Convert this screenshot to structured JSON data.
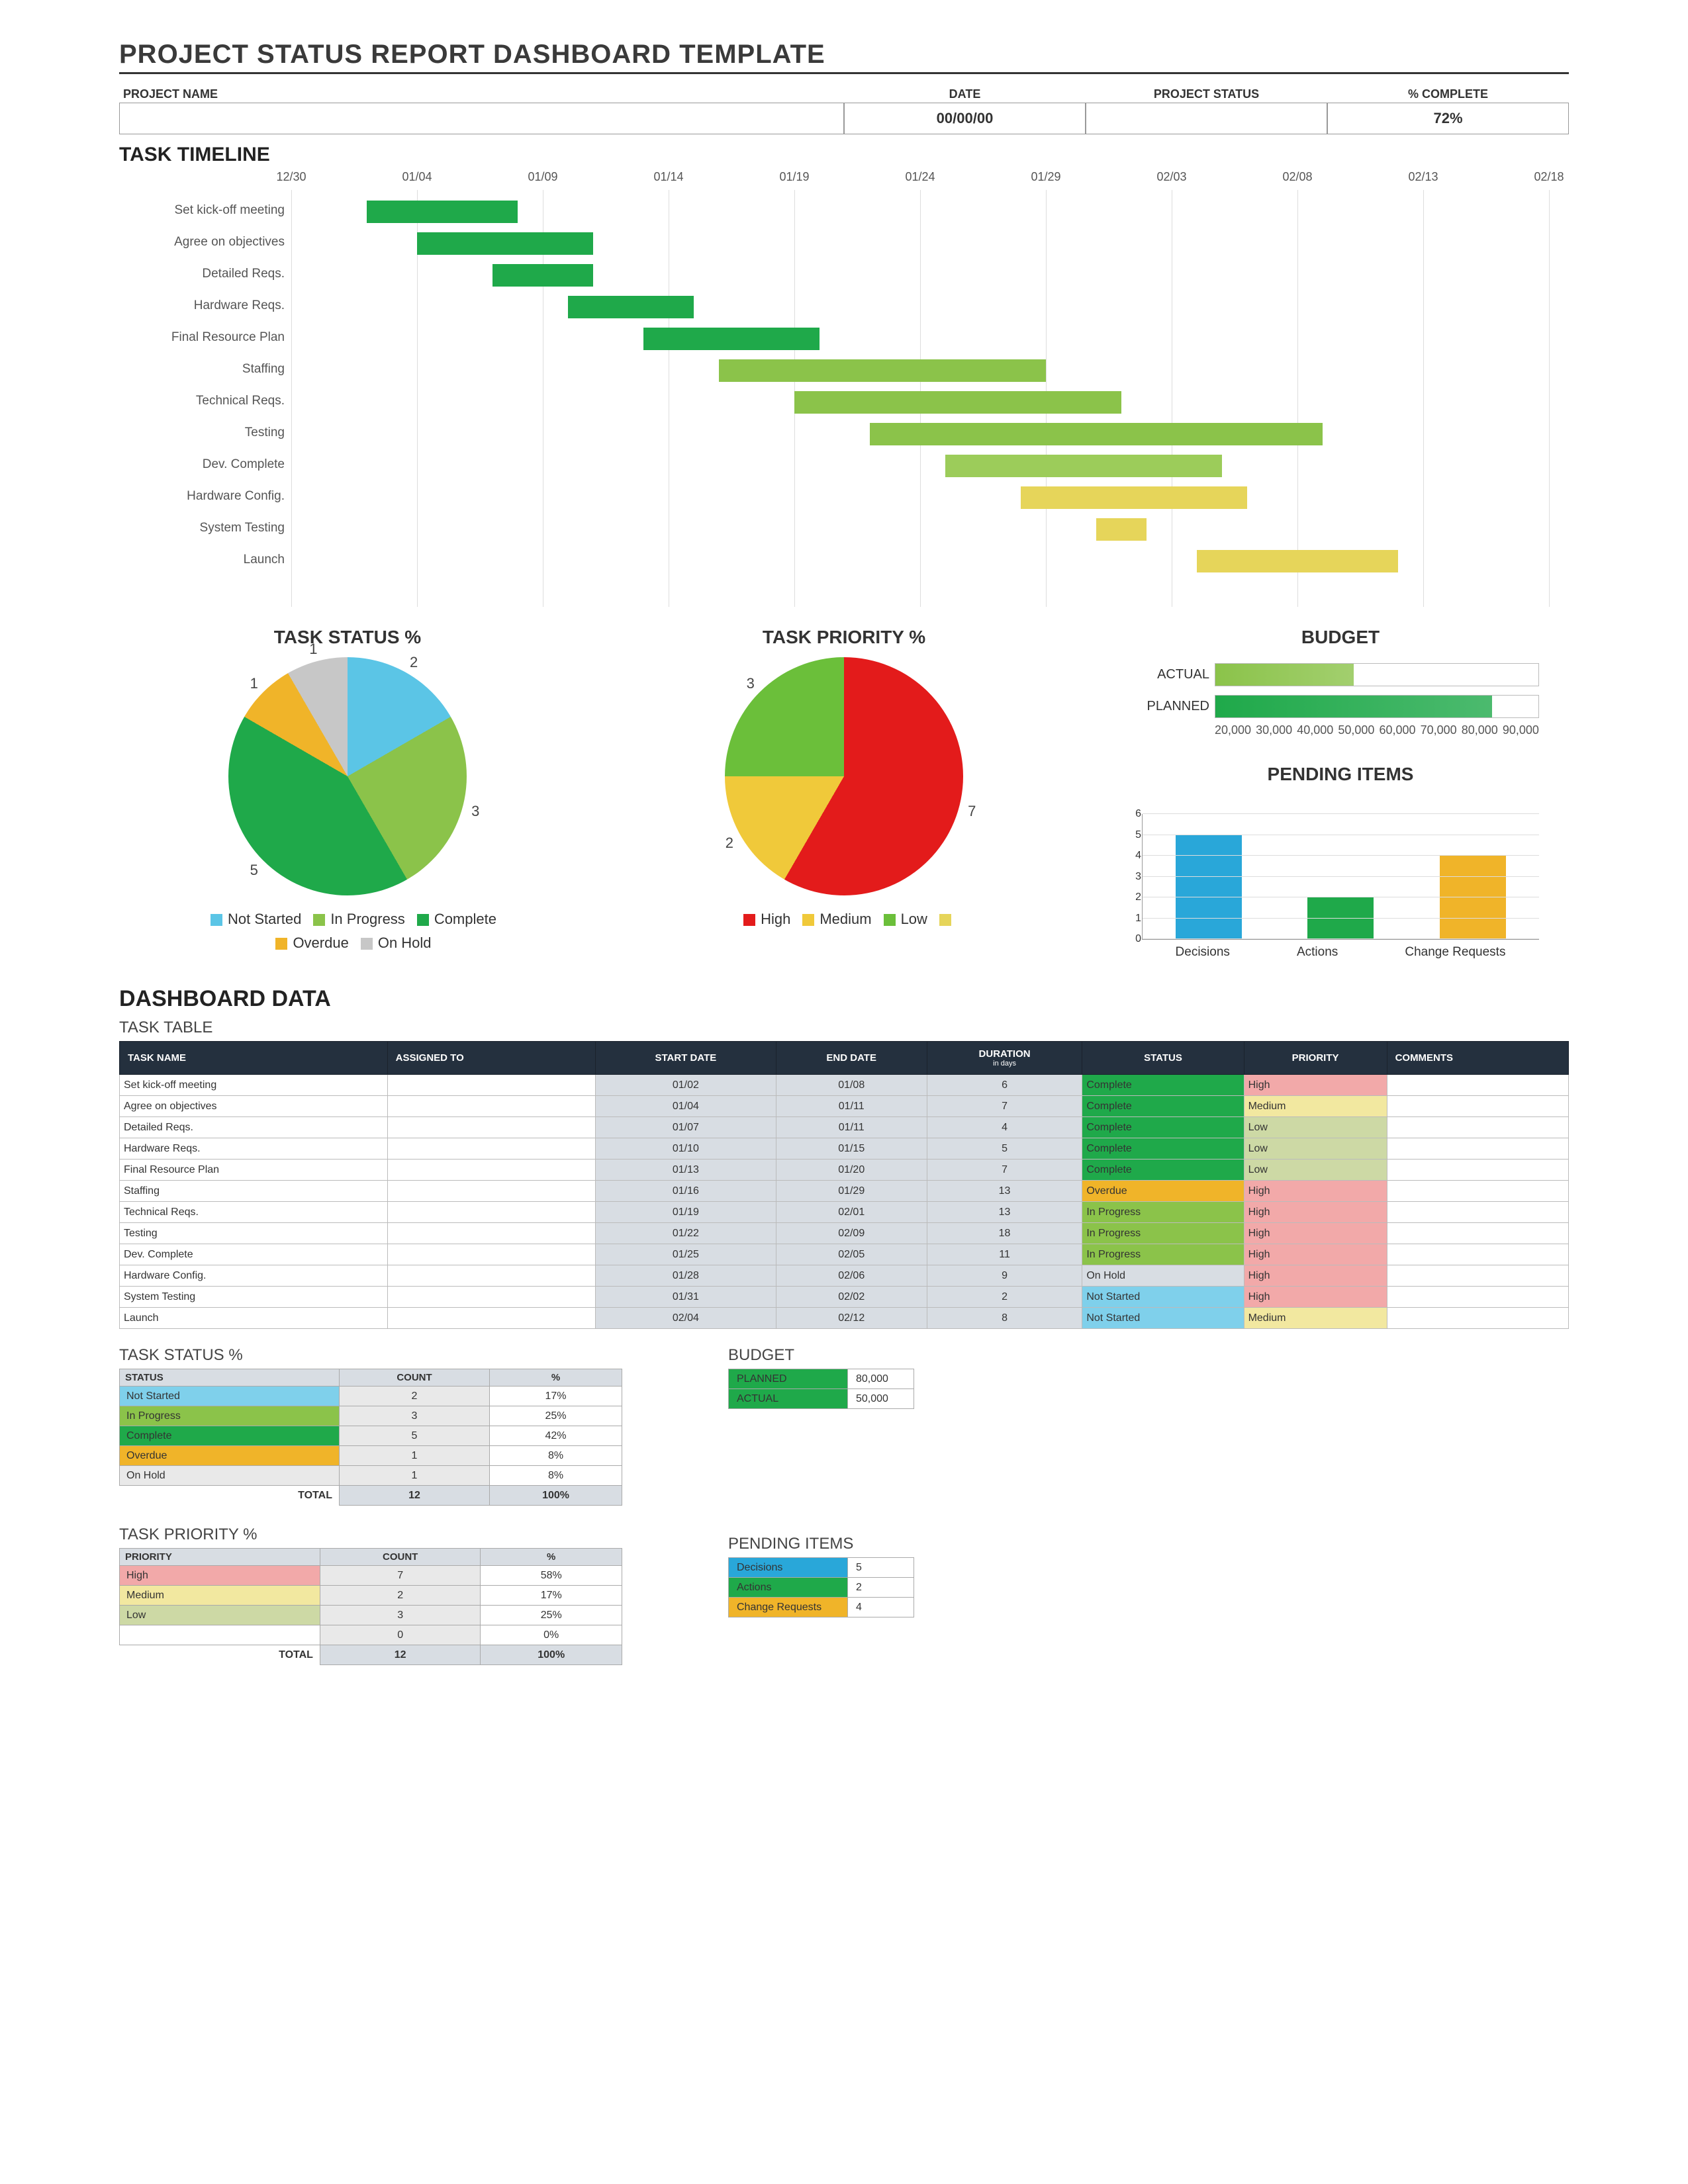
{
  "page_title": "PROJECT STATUS REPORT DASHBOARD TEMPLATE",
  "header": {
    "project_name": {
      "label": "PROJECT NAME",
      "value": ""
    },
    "date": {
      "label": "DATE",
      "value": "00/00/00"
    },
    "status": {
      "label": "PROJECT STATUS",
      "value": ""
    },
    "complete": {
      "label": "% COMPLETE",
      "value": "72%"
    }
  },
  "timeline": {
    "title": "TASK TIMELINE",
    "dates": [
      "12/30",
      "01/04",
      "01/09",
      "01/14",
      "01/19",
      "01/24",
      "01/29",
      "02/03",
      "02/08",
      "02/13",
      "02/18"
    ],
    "tasks": [
      {
        "name": "Set kick-off meeting",
        "start": "01/02",
        "end": "01/08",
        "color": "#1fa94a"
      },
      {
        "name": "Agree on objectives",
        "start": "01/04",
        "end": "01/11",
        "color": "#1fa94a"
      },
      {
        "name": "Detailed Reqs.",
        "start": "01/07",
        "end": "01/11",
        "color": "#1fa94a"
      },
      {
        "name": "Hardware Reqs.",
        "start": "01/10",
        "end": "01/15",
        "color": "#1fa94a"
      },
      {
        "name": "Final Resource Plan",
        "start": "01/13",
        "end": "01/20",
        "color": "#1fa94a"
      },
      {
        "name": "Staffing",
        "start": "01/16",
        "end": "01/29",
        "color": "#8bc34a"
      },
      {
        "name": "Technical Reqs.",
        "start": "01/19",
        "end": "02/01",
        "color": "#8bc34a"
      },
      {
        "name": "Testing",
        "start": "01/22",
        "end": "02/09",
        "color": "#8bc34a"
      },
      {
        "name": "Dev. Complete",
        "start": "01/25",
        "end": "02/05",
        "color": "#9ccc5a"
      },
      {
        "name": "Hardware Config.",
        "start": "01/28",
        "end": "02/06",
        "color": "#e6d55a"
      },
      {
        "name": "System Testing",
        "start": "01/31",
        "end": "02/02",
        "color": "#e6d55a"
      },
      {
        "name": "Launch",
        "start": "02/04",
        "end": "02/12",
        "color": "#e6d55a"
      }
    ]
  },
  "chart_data": [
    {
      "type": "pie",
      "title": "TASK STATUS %",
      "series": [
        {
          "name": "Not Started",
          "value": 2,
          "color": "#5bc5e6"
        },
        {
          "name": "In Progress",
          "value": 3,
          "color": "#8bc34a"
        },
        {
          "name": "Complete",
          "value": 5,
          "color": "#1fa94a"
        },
        {
          "name": "Overdue",
          "value": 1,
          "color": "#f0b429"
        },
        {
          "name": "On Hold",
          "value": 1,
          "color": "#c7c7c7"
        }
      ],
      "legend": [
        "Not Started",
        "In Progress",
        "Complete",
        "Overdue",
        "On Hold"
      ]
    },
    {
      "type": "pie",
      "title": "TASK PRIORITY %",
      "series": [
        {
          "name": "High",
          "value": 7,
          "color": "#e31b1b"
        },
        {
          "name": "Medium",
          "value": 2,
          "color": "#f0c93a"
        },
        {
          "name": "Low",
          "value": 3,
          "color": "#6bbf3a"
        },
        {
          "name": "",
          "value": 0,
          "color": "#e6d55a"
        }
      ],
      "legend": [
        "High",
        "Medium",
        "Low",
        ""
      ]
    },
    {
      "type": "bar",
      "title": "BUDGET",
      "orientation": "horizontal",
      "categories": [
        "ACTUAL",
        "PLANNED"
      ],
      "values": [
        50000,
        80000
      ],
      "colors": [
        "#8bc34a",
        "#1fa94a"
      ],
      "xticks": [
        20000,
        30000,
        40000,
        50000,
        60000,
        70000,
        80000,
        90000
      ]
    },
    {
      "type": "bar",
      "title": "PENDING ITEMS",
      "categories": [
        "Decisions",
        "Actions",
        "Change Requests"
      ],
      "values": [
        5,
        2,
        4
      ],
      "colors": [
        "#29a7d9",
        "#1fa94a",
        "#f0b429"
      ],
      "ylim": [
        0,
        6
      ],
      "yticks": [
        0,
        1,
        2,
        3,
        4,
        5,
        6
      ]
    }
  ],
  "dashboard_data_title": "DASHBOARD DATA",
  "task_table": {
    "title": "TASK TABLE",
    "headers": [
      "TASK NAME",
      "ASSIGNED TO",
      "START DATE",
      "END DATE",
      "DURATION in days",
      "STATUS",
      "PRIORITY",
      "COMMENTS"
    ],
    "rows": [
      {
        "name": "Set kick-off meeting",
        "assigned": "",
        "start": "01/02",
        "end": "01/08",
        "dur": "6",
        "status": "Complete",
        "status_bg": "#1fa94a",
        "priority": "High",
        "pri_bg": "#f2a9a9",
        "comments": ""
      },
      {
        "name": "Agree on objectives",
        "assigned": "",
        "start": "01/04",
        "end": "01/11",
        "dur": "7",
        "status": "Complete",
        "status_bg": "#1fa94a",
        "priority": "Medium",
        "pri_bg": "#f2e8a0",
        "comments": ""
      },
      {
        "name": "Detailed Reqs.",
        "assigned": "",
        "start": "01/07",
        "end": "01/11",
        "dur": "4",
        "status": "Complete",
        "status_bg": "#1fa94a",
        "priority": "Low",
        "pri_bg": "#cdd9a5",
        "comments": ""
      },
      {
        "name": "Hardware Reqs.",
        "assigned": "",
        "start": "01/10",
        "end": "01/15",
        "dur": "5",
        "status": "Complete",
        "status_bg": "#1fa94a",
        "priority": "Low",
        "pri_bg": "#cdd9a5",
        "comments": ""
      },
      {
        "name": "Final Resource Plan",
        "assigned": "",
        "start": "01/13",
        "end": "01/20",
        "dur": "7",
        "status": "Complete",
        "status_bg": "#1fa94a",
        "priority": "Low",
        "pri_bg": "#cdd9a5",
        "comments": ""
      },
      {
        "name": "Staffing",
        "assigned": "",
        "start": "01/16",
        "end": "01/29",
        "dur": "13",
        "status": "Overdue",
        "status_bg": "#f0b429",
        "priority": "High",
        "pri_bg": "#f2a9a9",
        "comments": ""
      },
      {
        "name": "Technical Reqs.",
        "assigned": "",
        "start": "01/19",
        "end": "02/01",
        "dur": "13",
        "status": "In Progress",
        "status_bg": "#8bc34a",
        "priority": "High",
        "pri_bg": "#f2a9a9",
        "comments": ""
      },
      {
        "name": "Testing",
        "assigned": "",
        "start": "01/22",
        "end": "02/09",
        "dur": "18",
        "status": "In Progress",
        "status_bg": "#8bc34a",
        "priority": "High",
        "pri_bg": "#f2a9a9",
        "comments": ""
      },
      {
        "name": "Dev. Complete",
        "assigned": "",
        "start": "01/25",
        "end": "02/05",
        "dur": "11",
        "status": "In Progress",
        "status_bg": "#8bc34a",
        "priority": "High",
        "pri_bg": "#f2a9a9",
        "comments": ""
      },
      {
        "name": "Hardware Config.",
        "assigned": "",
        "start": "01/28",
        "end": "02/06",
        "dur": "9",
        "status": "On Hold",
        "status_bg": "#d8dde3",
        "priority": "High",
        "pri_bg": "#f2a9a9",
        "comments": ""
      },
      {
        "name": "System Testing",
        "assigned": "",
        "start": "01/31",
        "end": "02/02",
        "dur": "2",
        "status": "Not Started",
        "status_bg": "#7fd0eb",
        "priority": "High",
        "pri_bg": "#f2a9a9",
        "comments": ""
      },
      {
        "name": "Launch",
        "assigned": "",
        "start": "02/04",
        "end": "02/12",
        "dur": "8",
        "status": "Not Started",
        "status_bg": "#7fd0eb",
        "priority": "Medium",
        "pri_bg": "#f2e8a0",
        "comments": ""
      }
    ]
  },
  "status_table": {
    "title": "TASK STATUS %",
    "headers": [
      "STATUS",
      "COUNT",
      "%"
    ],
    "rows": [
      {
        "label": "Not Started",
        "bg": "#7fd0eb",
        "count": 2,
        "pct": "17%"
      },
      {
        "label": "In Progress",
        "bg": "#8bc34a",
        "count": 3,
        "pct": "25%"
      },
      {
        "label": "Complete",
        "bg": "#1fa94a",
        "count": 5,
        "pct": "42%"
      },
      {
        "label": "Overdue",
        "bg": "#f0b429",
        "count": 1,
        "pct": "8%"
      },
      {
        "label": "On Hold",
        "bg": "#e9e9e9",
        "count": 1,
        "pct": "8%"
      }
    ],
    "total": {
      "label": "TOTAL",
      "count": 12,
      "pct": "100%"
    }
  },
  "priority_table": {
    "title": "TASK PRIORITY %",
    "headers": [
      "PRIORITY",
      "COUNT",
      "%"
    ],
    "rows": [
      {
        "label": "High",
        "bg": "#f2a9a9",
        "count": 7,
        "pct": "58%"
      },
      {
        "label": "Medium",
        "bg": "#f2e8a0",
        "count": 2,
        "pct": "17%"
      },
      {
        "label": "Low",
        "bg": "#cdd9a5",
        "count": 3,
        "pct": "25%"
      },
      {
        "label": "",
        "bg": "#ffffff",
        "count": 0,
        "pct": "0%"
      }
    ],
    "total": {
      "label": "TOTAL",
      "count": 12,
      "pct": "100%"
    }
  },
  "budget_table": {
    "title": "BUDGET",
    "rows": [
      {
        "label": "PLANNED",
        "bg": "#1fa94a",
        "value": "80,000"
      },
      {
        "label": "ACTUAL",
        "bg": "#1fa94a",
        "value": "50,000"
      }
    ]
  },
  "pending_table": {
    "title": "PENDING ITEMS",
    "rows": [
      {
        "label": "Decisions",
        "bg": "#29a7d9",
        "value": 5
      },
      {
        "label": "Actions",
        "bg": "#1fa94a",
        "value": 2
      },
      {
        "label": "Change Requests",
        "bg": "#f0b429",
        "value": 4
      }
    ]
  }
}
